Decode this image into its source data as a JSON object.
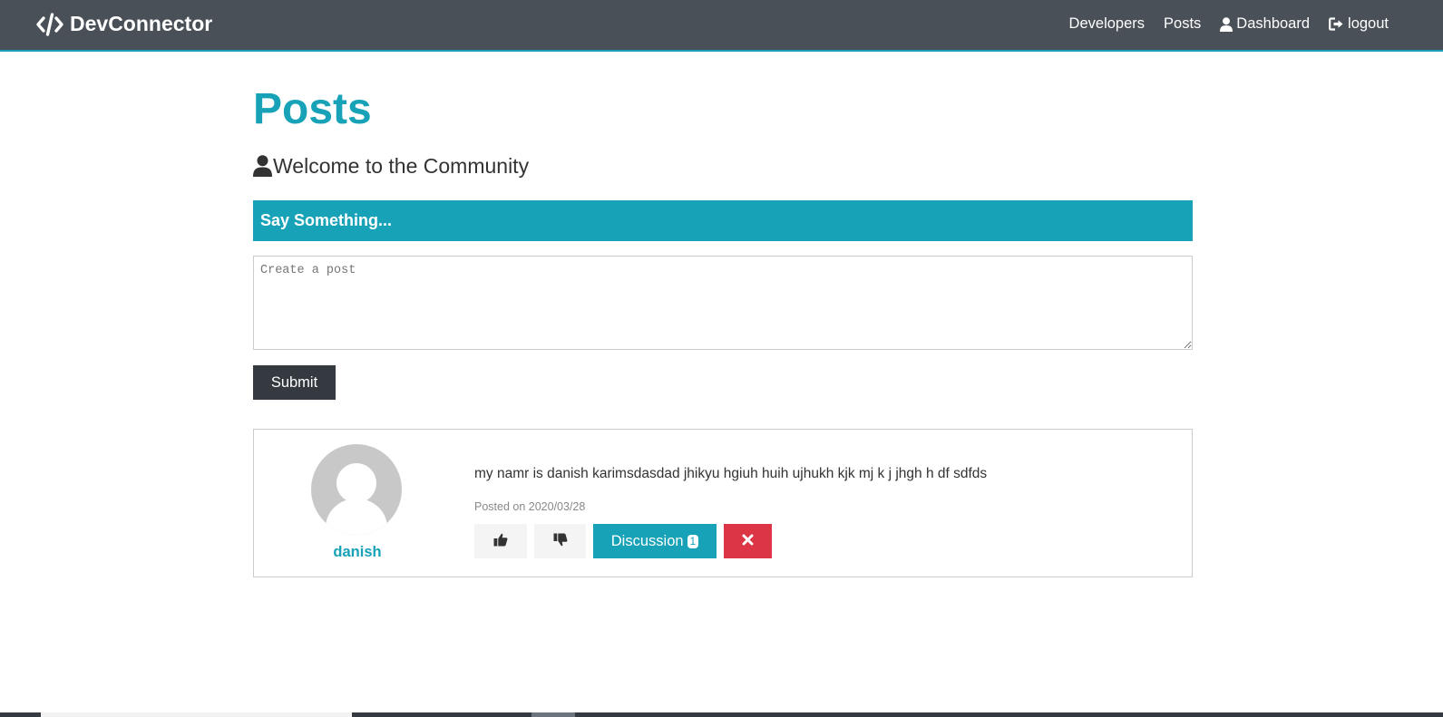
{
  "navbar": {
    "brand": "DevConnector",
    "brand_icon": "code-icon",
    "links": [
      {
        "label": "Developers"
      },
      {
        "label": "Posts"
      },
      {
        "label": "Dashboard",
        "icon": "user-icon"
      },
      {
        "label": "logout",
        "icon": "sign-out-icon"
      }
    ],
    "background": "#495057",
    "accent": "#17a2b8"
  },
  "page": {
    "title": "Posts",
    "lead": "Welcome to the Community",
    "lead_icon": "user-icon"
  },
  "post_form": {
    "header": "Say Something...",
    "placeholder": "Create a post",
    "submit_label": "Submit"
  },
  "posts": [
    {
      "author": "danish",
      "avatar": "default-avatar",
      "text": "my namr is danish karimsdasdad jhikyu hgiuh huih ujhukh kjk mj k j jhgh h df sdfds",
      "date": "Posted on 2020/03/28",
      "like_icon": "thumbs-up-icon",
      "dislike_icon": "thumbs-down-icon",
      "discussion_label": "Discussion",
      "comment_count": "1",
      "delete_icon": "times-icon"
    }
  ],
  "colors": {
    "primary": "#17a2b8",
    "dark": "#343a40",
    "danger": "#dc3545",
    "light": "#f4f4f4"
  }
}
